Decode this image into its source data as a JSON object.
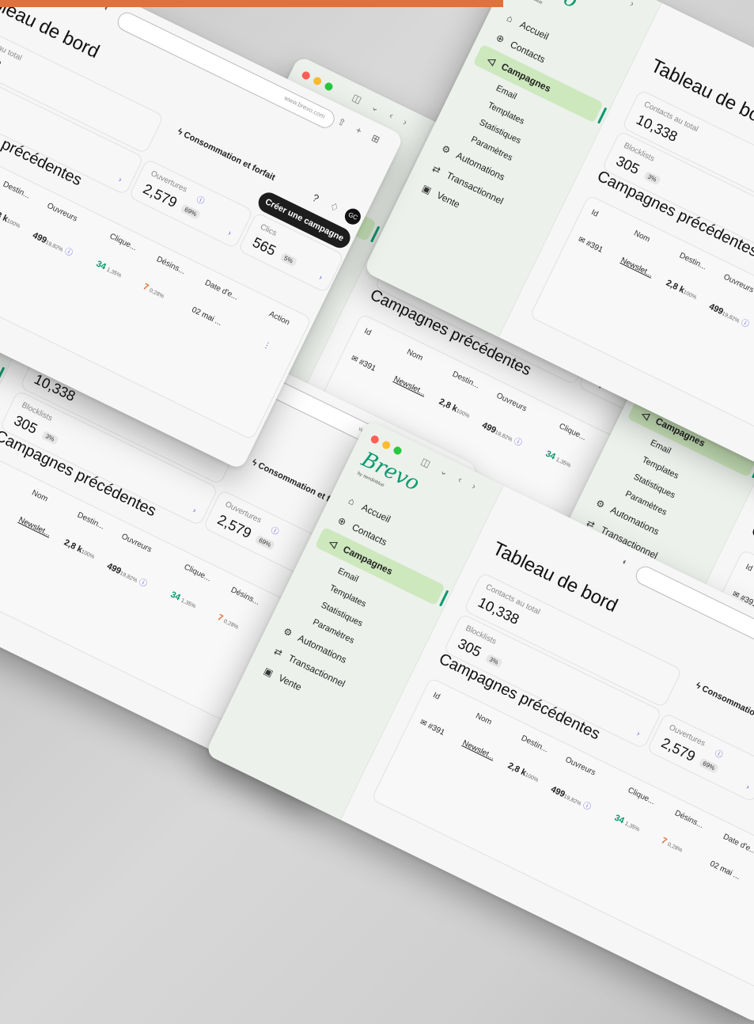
{
  "window": {
    "tool_icons": "◫ ⌄ ‹ ›",
    "url": "www.brevo.com",
    "top_icons": "⇧ + ⊞"
  },
  "brand": {
    "logo": "Brevo",
    "tagline": "by sendinblue",
    "accent": "#0b996e",
    "active_bg": "#cde8bd",
    "orange": "#e0703c"
  },
  "sidebar": {
    "items": [
      {
        "label": "Accueil",
        "icon": "home-icon",
        "glyph": "⌂"
      },
      {
        "label": "Contacts",
        "icon": "contacts-icon",
        "glyph": "⊕"
      },
      {
        "label": "Campagnes",
        "icon": "send-icon",
        "glyph": "◁"
      },
      {
        "label": "Email",
        "sub": true
      },
      {
        "label": "Templates",
        "sub": true
      },
      {
        "label": "Statistiques",
        "sub": true
      },
      {
        "label": "Paramètres",
        "sub": true
      },
      {
        "label": "Automations",
        "icon": "automations-icon",
        "glyph": "⚙"
      },
      {
        "label": "Transactionnel",
        "icon": "transactional-icon",
        "glyph": "⇄"
      },
      {
        "label": "Vente",
        "icon": "sales-icon",
        "glyph": "▣"
      }
    ]
  },
  "header": {
    "title": "Tableau de bord",
    "consommation": "ϟ Consommation et forfait",
    "help_glyph": "?",
    "bell_glyph": "♢",
    "avatar": "GC",
    "chevron": "⌄",
    "create_button": "Créer une campagne"
  },
  "stats": {
    "contacts": {
      "label": "Contacts au total",
      "value": "10,338"
    },
    "blocklists": {
      "label": "Blocklists",
      "value": "305",
      "pct": "3%"
    },
    "ouvertures": {
      "label": "Ouvertures",
      "value": "2,579",
      "pct": "69%",
      "info": "ⓘ"
    },
    "clics": {
      "label": "Clics",
      "value": "565",
      "pct": "5%"
    },
    "chevron": "›"
  },
  "campaigns": {
    "title": "Campagnes précédentes",
    "columns": [
      "Id",
      "Nom",
      "Destin...",
      "Ouvreurs",
      "Clique...",
      "Désins...",
      "Date d'e...",
      "Action"
    ],
    "row": {
      "id": "#391",
      "name": "Newslet...",
      "dest": "2,8 k",
      "dest_pct": "100%",
      "openers": "499",
      "openers_pct": "19,82%",
      "clicks": "34",
      "clicks_pct": "1,35%",
      "unsubs": "7",
      "unsubs_pct": "0,28%",
      "date": "02 mai ...",
      "action": "⋮"
    }
  }
}
